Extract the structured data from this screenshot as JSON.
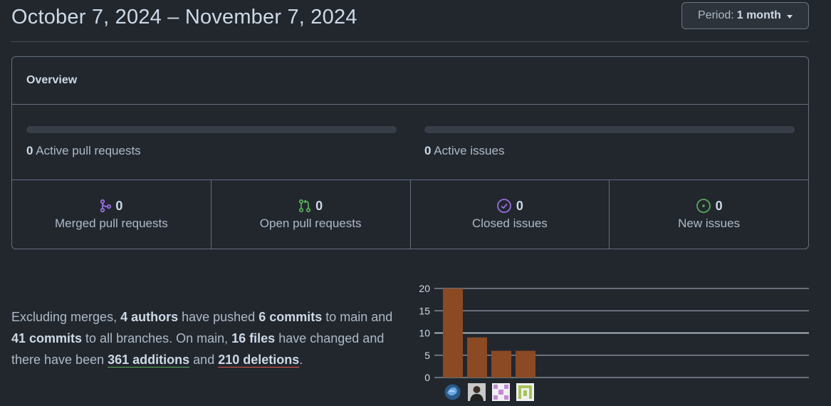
{
  "header": {
    "date_range": "October 7, 2024 – November 7, 2024",
    "period_label": "Period:",
    "period_value": "1 month"
  },
  "overview": {
    "title": "Overview",
    "active_pull_requests": {
      "count": "0",
      "label": "Active pull requests"
    },
    "active_issues": {
      "count": "0",
      "label": "Active issues"
    },
    "stats": [
      {
        "count": "0",
        "label": "Merged pull requests",
        "icon": "git-merge-icon",
        "color": "#986ee2"
      },
      {
        "count": "0",
        "label": "Open pull requests",
        "icon": "git-pull-request-icon",
        "color": "#57ab5a"
      },
      {
        "count": "0",
        "label": "Closed issues",
        "icon": "issue-closed-icon",
        "color": "#986ee2"
      },
      {
        "count": "0",
        "label": "New issues",
        "icon": "issue-opened-icon",
        "color": "#57ab5a"
      }
    ]
  },
  "summary": {
    "p1": "Excluding merges, ",
    "authors": "4 authors",
    "p2": " have pushed ",
    "commits_main": "6 commits",
    "p3": " to main and ",
    "commits_all": "41 commits",
    "p4": " to all branches. On main, ",
    "files": "16 files",
    "p5": " have changed and there have been ",
    "additions_num": "361",
    "additions_word": "additions",
    "p6": " and ",
    "deletions_num": "210",
    "deletions_word": "deletions",
    "p7": "."
  },
  "chart_data": {
    "type": "bar",
    "categories": [
      "author-1",
      "author-2",
      "author-3",
      "author-4"
    ],
    "values": [
      20,
      9,
      6,
      6
    ],
    "ylim": [
      0,
      20
    ],
    "yticks": [
      0,
      5,
      10,
      15,
      20
    ],
    "bar_color": "#8b4a24",
    "grid": true
  }
}
